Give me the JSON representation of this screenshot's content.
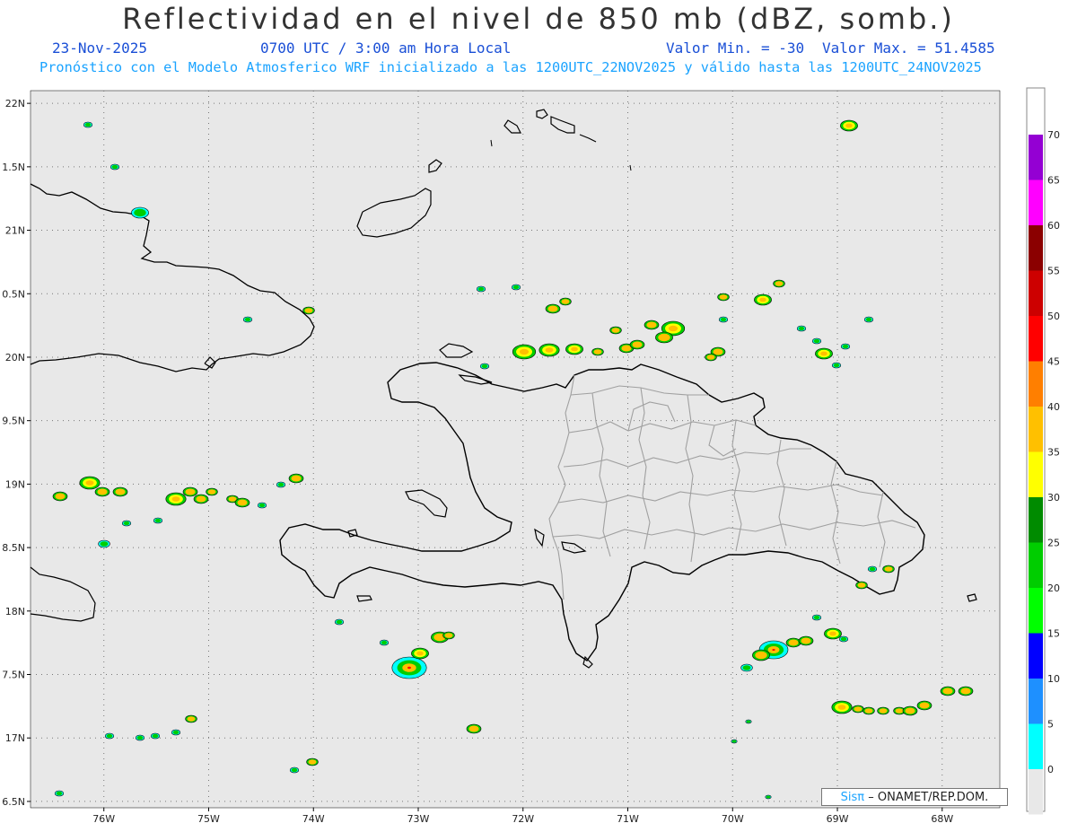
{
  "title": "Reflectividad en el nivel de 850 mb (dBZ, somb.)",
  "date": "23-Nov-2025",
  "time": "0700 UTC / 3:00 am Hora Local",
  "valor_min": "Valor Min. = -30",
  "valor_max": "Valor Max. = 51.4585",
  "forecast_info": "Pronóstico con el Modelo Atmosferico WRF inicializado a las 1200UTC_22NOV2025 y válido hasta las  1200UTC_24NOV2025",
  "credit": {
    "prefix": "Sisπ",
    "text": "– ONAMET/REP.DOM."
  },
  "axes": {
    "lon_labels": [
      "76W",
      "75W",
      "74W",
      "73W",
      "72W",
      "71W",
      "70W",
      "69W",
      "68W"
    ],
    "lon_values": [
      -76,
      -75,
      -74,
      -73,
      -72,
      -71,
      -70,
      -69,
      -68
    ],
    "lat_labels": [
      "22N",
      "1.5N",
      "21N",
      "0.5N",
      "20N",
      "9.5N",
      "19N",
      "8.5N",
      "18N",
      "7.5N",
      "17N",
      "6.5N"
    ],
    "lat_values": [
      22,
      21.5,
      21,
      20.5,
      20,
      19.5,
      19,
      18.5,
      18,
      17.5,
      17,
      16.5
    ],
    "lon_range": [
      -76.7,
      -67.45
    ],
    "lat_range": [
      16.45,
      22.1
    ]
  },
  "colorbar": {
    "levels": [
      "70",
      "65",
      "60",
      "55",
      "50",
      "45",
      "40",
      "35",
      "30",
      "25",
      "20",
      "15",
      "10",
      "5",
      "0"
    ],
    "colors": [
      "#9400d3",
      "#ff00ff",
      "#8b0000",
      "#cd0000",
      "#ff0000",
      "#ff7f00",
      "#ffc000",
      "#ffff00",
      "#008b00",
      "#00cd00",
      "#00ff00",
      "#0000ff",
      "#1e90ff",
      "#00ffff",
      "#e8e8e8"
    ]
  },
  "colors": {
    "background": "#e8e8e8",
    "coast": "#000000",
    "provinces": "#a0a0a0"
  }
}
